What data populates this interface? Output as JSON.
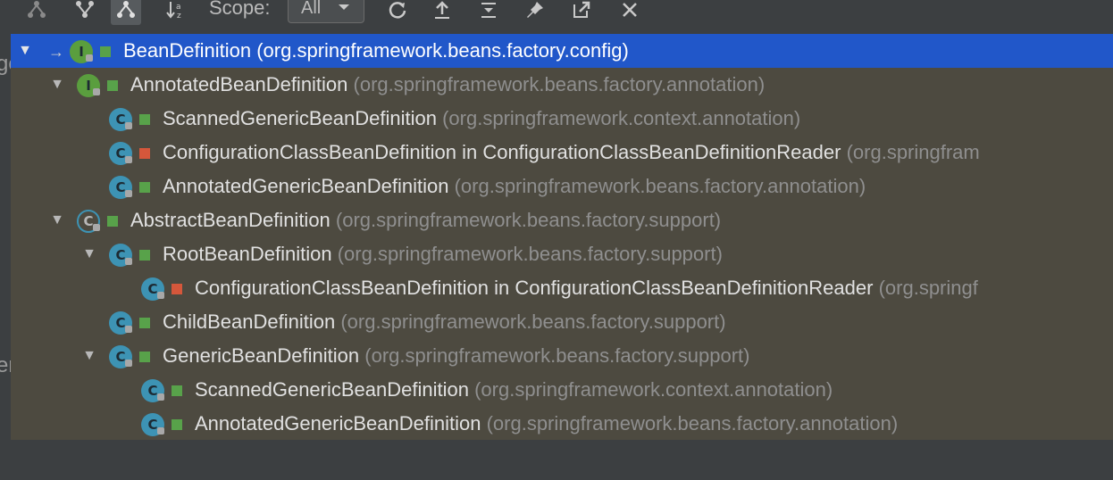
{
  "toolbar": {
    "buttons": [
      {
        "name": "supertypes-hierarchy-icon"
      },
      {
        "name": "subtypes-hierarchy-icon"
      },
      {
        "name": "class-hierarchy-icon",
        "active": true
      },
      {
        "name": "sort-alphabetically-icon"
      }
    ],
    "scope_label": "Scope:",
    "scope_value": "All",
    "actions": [
      {
        "name": "refresh-icon"
      },
      {
        "name": "export-icon"
      },
      {
        "name": "expand-all-icon"
      },
      {
        "name": "pin-icon"
      },
      {
        "name": "open-in-new-icon"
      },
      {
        "name": "close-icon"
      }
    ]
  },
  "left_fragments": [
    "ge",
    "er"
  ],
  "tree": {
    "rows": [
      {
        "name": "BeanDefinition",
        "package": "(org.springframework.beans.factory.config)",
        "kind": "interface",
        "visibility": "public",
        "expanded": true,
        "selected": true,
        "root": true
      },
      {
        "name": "AnnotatedBeanDefinition",
        "package": "(org.springframework.beans.factory.annotation)",
        "kind": "interface",
        "visibility": "public",
        "expanded": true
      },
      {
        "name": "ScannedGenericBeanDefinition",
        "package": "(org.springframework.context.annotation)",
        "kind": "class",
        "visibility": "public"
      },
      {
        "name": "ConfigurationClassBeanDefinition in ConfigurationClassBeanDefinitionReader",
        "package": "(org.springfram",
        "kind": "class",
        "visibility": "private"
      },
      {
        "name": "AnnotatedGenericBeanDefinition",
        "package": "(org.springframework.beans.factory.annotation)",
        "kind": "class",
        "visibility": "public"
      },
      {
        "name": "AbstractBeanDefinition",
        "package": "(org.springframework.beans.factory.support)",
        "kind": "abstract",
        "visibility": "public",
        "expanded": true
      },
      {
        "name": "RootBeanDefinition",
        "package": "(org.springframework.beans.factory.support)",
        "kind": "class",
        "visibility": "public",
        "expanded": true
      },
      {
        "name": "ConfigurationClassBeanDefinition in ConfigurationClassBeanDefinitionReader",
        "package": "(org.springf",
        "kind": "class",
        "visibility": "private"
      },
      {
        "name": "ChildBeanDefinition",
        "package": "(org.springframework.beans.factory.support)",
        "kind": "class",
        "visibility": "public"
      },
      {
        "name": "GenericBeanDefinition",
        "package": "(org.springframework.beans.factory.support)",
        "kind": "class",
        "visibility": "public",
        "expanded": true
      },
      {
        "name": "ScannedGenericBeanDefinition",
        "package": "(org.springframework.context.annotation)",
        "kind": "class",
        "visibility": "public"
      },
      {
        "name": "AnnotatedGenericBeanDefinition",
        "package": "(org.springframework.beans.factory.annotation)",
        "kind": "class",
        "visibility": "public"
      }
    ]
  },
  "colors": {
    "selection": "#2157c9",
    "tree_background": "#4d4a40",
    "class_icon": "#3d93b4",
    "interface_icon": "#5a9e3e",
    "public_marker": "#58a24a",
    "private_marker": "#d5573b"
  }
}
